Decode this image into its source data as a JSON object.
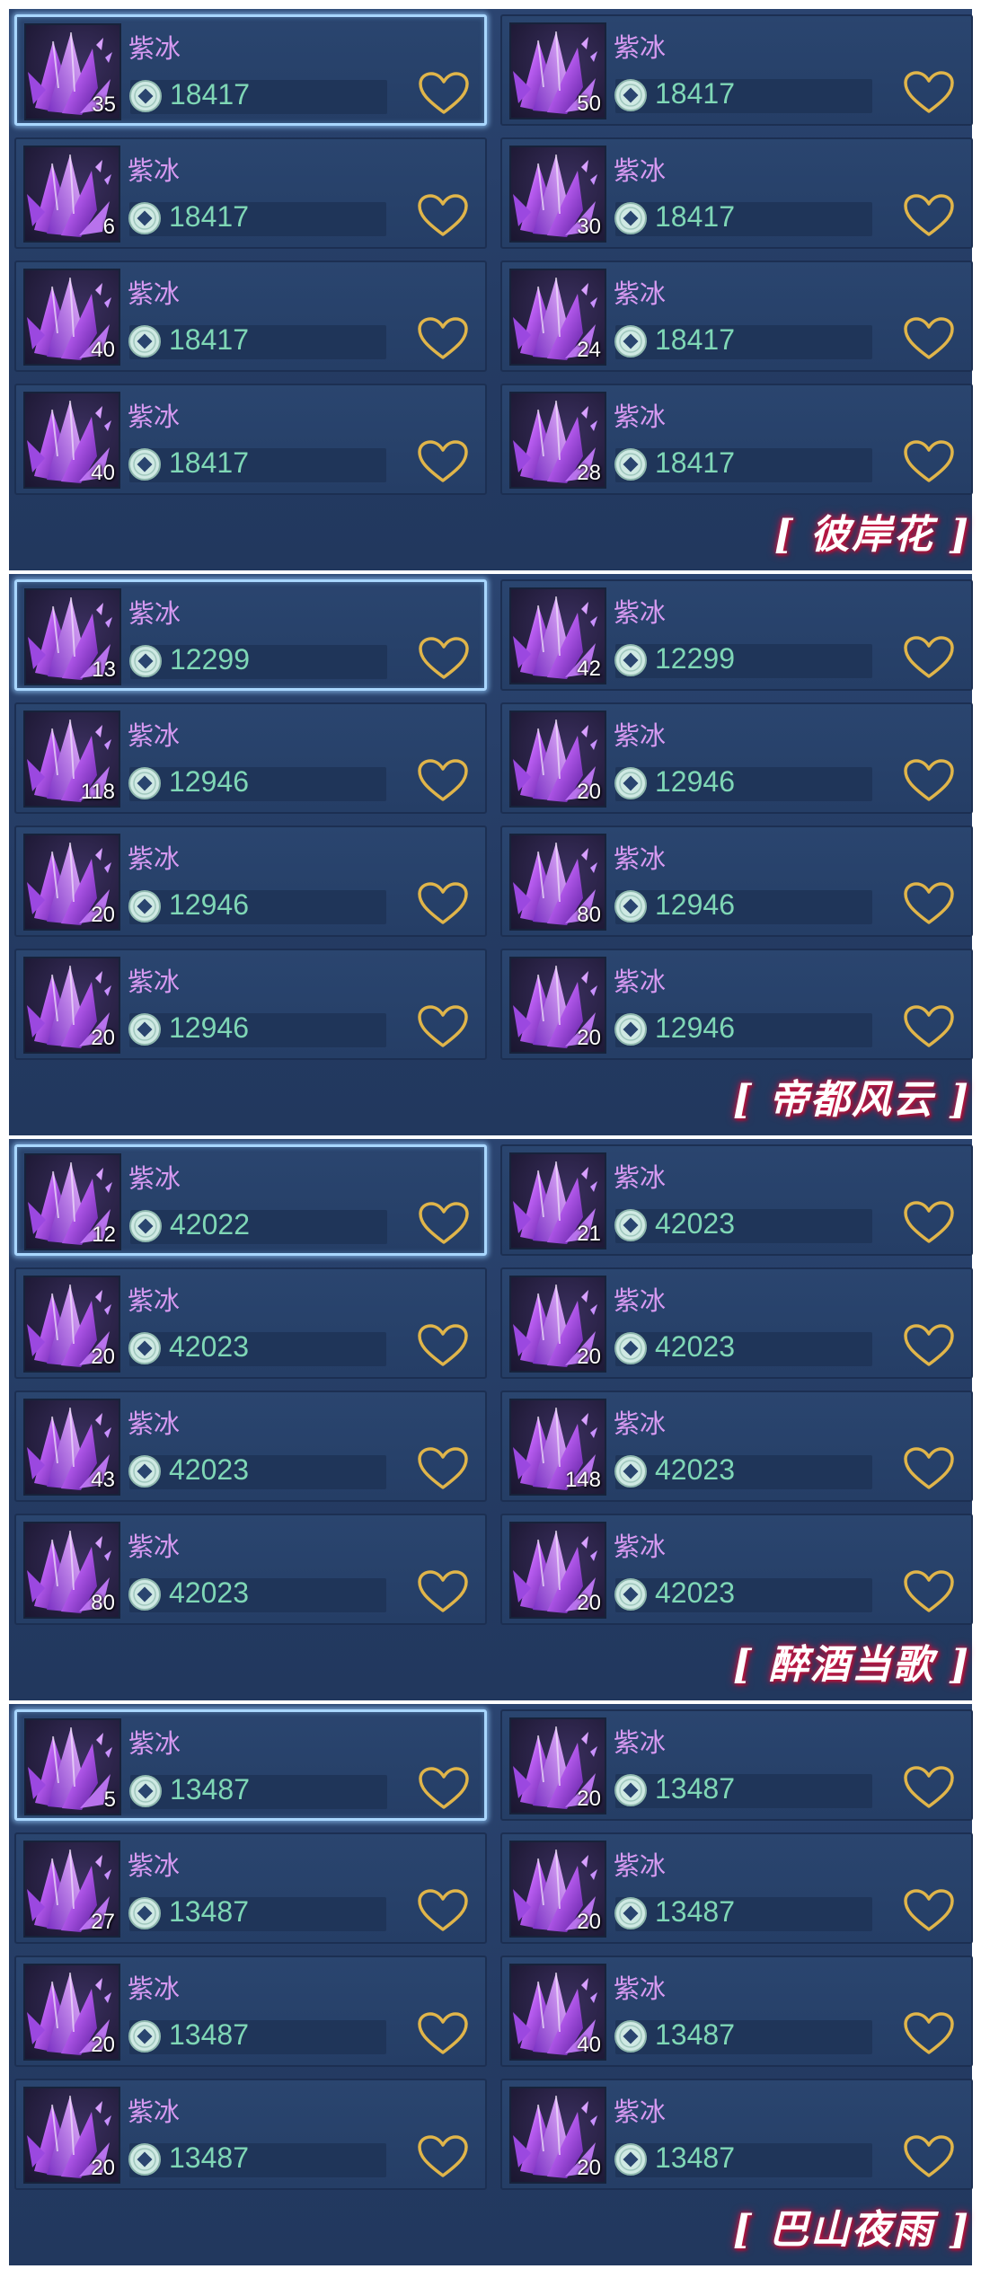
{
  "panels": [
    {
      "server": "[ 彼岸花 ]",
      "items": [
        {
          "name": "紫冰",
          "qty": "35",
          "price": "18417",
          "selected": true
        },
        {
          "name": "紫冰",
          "qty": "50",
          "price": "18417"
        },
        {
          "name": "紫冰",
          "qty": "6",
          "price": "18417"
        },
        {
          "name": "紫冰",
          "qty": "30",
          "price": "18417"
        },
        {
          "name": "紫冰",
          "qty": "40",
          "price": "18417"
        },
        {
          "name": "紫冰",
          "qty": "24",
          "price": "18417"
        },
        {
          "name": "紫冰",
          "qty": "40",
          "price": "18417"
        },
        {
          "name": "紫冰",
          "qty": "28",
          "price": "18417"
        }
      ]
    },
    {
      "server": "[ 帝都风云 ]",
      "items": [
        {
          "name": "紫冰",
          "qty": "13",
          "price": "12299",
          "selected": true
        },
        {
          "name": "紫冰",
          "qty": "42",
          "price": "12299"
        },
        {
          "name": "紫冰",
          "qty": "118",
          "price": "12946"
        },
        {
          "name": "紫冰",
          "qty": "20",
          "price": "12946"
        },
        {
          "name": "紫冰",
          "qty": "20",
          "price": "12946"
        },
        {
          "name": "紫冰",
          "qty": "80",
          "price": "12946"
        },
        {
          "name": "紫冰",
          "qty": "20",
          "price": "12946"
        },
        {
          "name": "紫冰",
          "qty": "20",
          "price": "12946"
        }
      ]
    },
    {
      "server": "[ 醉酒当歌 ]",
      "items": [
        {
          "name": "紫冰",
          "qty": "12",
          "price": "42022",
          "selected": true
        },
        {
          "name": "紫冰",
          "qty": "21",
          "price": "42023"
        },
        {
          "name": "紫冰",
          "qty": "20",
          "price": "42023"
        },
        {
          "name": "紫冰",
          "qty": "20",
          "price": "42023"
        },
        {
          "name": "紫冰",
          "qty": "43",
          "price": "42023"
        },
        {
          "name": "紫冰",
          "qty": "148",
          "price": "42023"
        },
        {
          "name": "紫冰",
          "qty": "80",
          "price": "42023"
        },
        {
          "name": "紫冰",
          "qty": "20",
          "price": "42023"
        }
      ]
    },
    {
      "server": "[ 巴山夜雨 ]",
      "items": [
        {
          "name": "紫冰",
          "qty": "5",
          "price": "13487",
          "selected": true
        },
        {
          "name": "紫冰",
          "qty": "20",
          "price": "13487"
        },
        {
          "name": "紫冰",
          "qty": "27",
          "price": "13487"
        },
        {
          "name": "紫冰",
          "qty": "20",
          "price": "13487"
        },
        {
          "name": "紫冰",
          "qty": "20",
          "price": "13487"
        },
        {
          "name": "紫冰",
          "qty": "40",
          "price": "13487"
        },
        {
          "name": "紫冰",
          "qty": "20",
          "price": "13487"
        },
        {
          "name": "紫冰",
          "qty": "20",
          "price": "13487"
        }
      ]
    }
  ],
  "icons": {
    "item": "purple-crystal-icon",
    "currency": "jade-coin-icon",
    "favorite": "heart-outline-icon"
  },
  "colors": {
    "name": "#d79af2",
    "price": "#7fd7b6",
    "heart": "#e0b54a",
    "server_glow": "#d01d4a",
    "panel": "#243b63"
  }
}
